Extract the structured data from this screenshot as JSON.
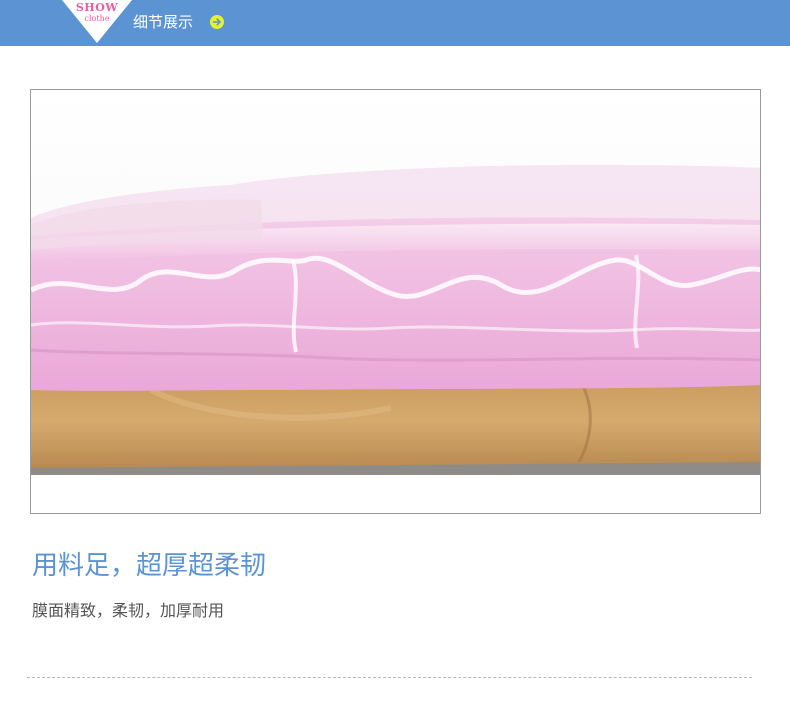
{
  "header": {
    "badge_top": "SHOW",
    "badge_bottom": "clothe",
    "title": "细节展示",
    "arrow_icon": "arrow-right-circle-icon",
    "bar_color": "#5b93d3",
    "badge_text_color": "#e8609b",
    "arrow_color": "#e6f22c"
  },
  "photo": {
    "subject": "pink vacuum storage bag with folded items",
    "accent_color": "#f0b6dc"
  },
  "feature": {
    "headline": "用料足，超厚超柔韧",
    "description": "膜面精致，柔韧，加厚耐用",
    "headline_color": "#5b93d3"
  }
}
